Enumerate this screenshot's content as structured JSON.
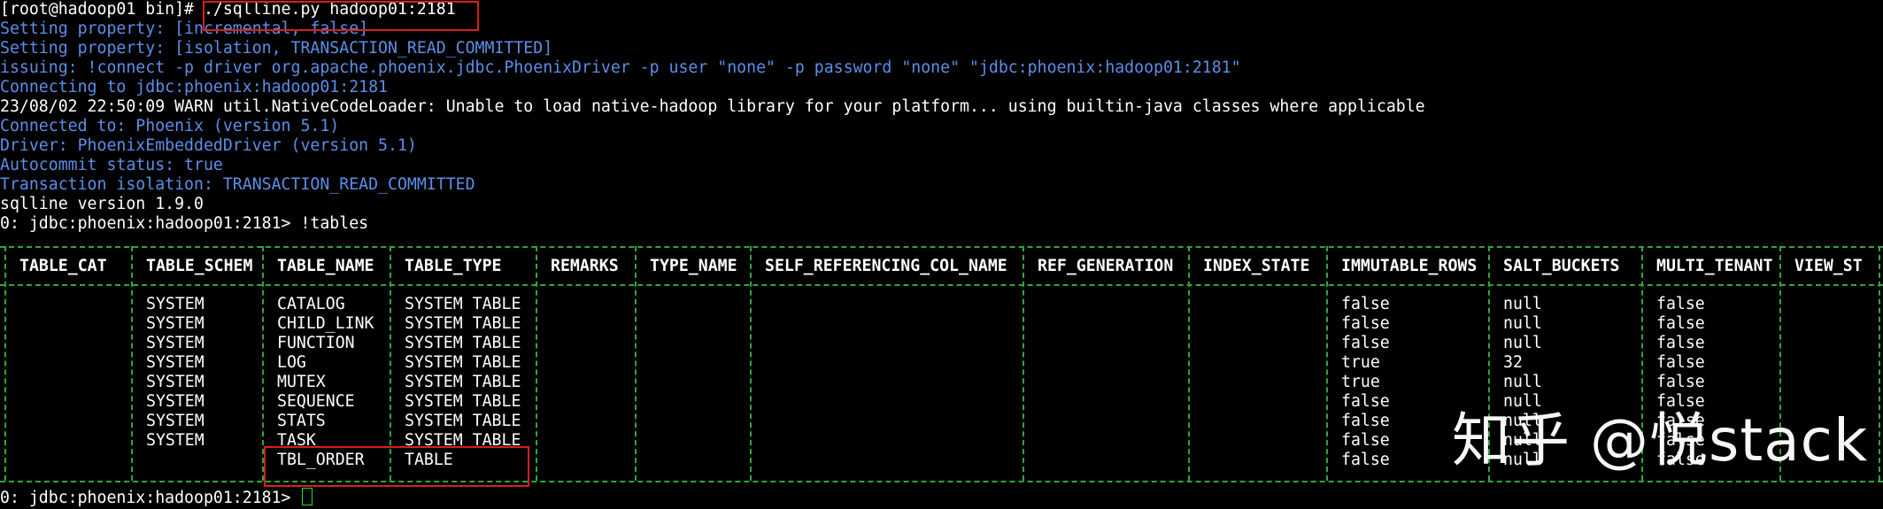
{
  "terminal": {
    "prompt_line": {
      "prompt": "[root@hadoop01 bin]# ",
      "command": "./sqlline.py hadoop01:2181"
    },
    "lines": [
      {
        "text": "Setting property: [incremental, false]",
        "color": "blue"
      },
      {
        "text": "Setting property: [isolation, TRANSACTION_READ_COMMITTED]",
        "color": "blue"
      },
      {
        "text": "issuing: !connect -p driver org.apache.phoenix.jdbc.PhoenixDriver -p user \"none\" -p password \"none\" \"jdbc:phoenix:hadoop01:2181\"",
        "color": "blue"
      },
      {
        "text": "Connecting to jdbc:phoenix:hadoop01:2181",
        "color": "blue"
      },
      {
        "text": "23/08/02 22:50:09 WARN util.NativeCodeLoader: Unable to load native-hadoop library for your platform... using builtin-java classes where applicable",
        "color": "white"
      },
      {
        "text": "Connected to: Phoenix (version 5.1)",
        "color": "blue"
      },
      {
        "text": "Driver: PhoenixEmbeddedDriver (version 5.1)",
        "color": "blue"
      },
      {
        "text": "Autocommit status: true",
        "color": "blue"
      },
      {
        "text": "Transaction isolation: TRANSACTION_READ_COMMITTED",
        "color": "blue"
      },
      {
        "text": "sqlline version 1.9.0",
        "color": "white"
      },
      {
        "text": "0: jdbc:phoenix:hadoop01:2181> !tables",
        "color": "white"
      }
    ],
    "final_prompt": "0: jdbc:phoenix:hadoop01:2181> "
  },
  "table": {
    "columns": [
      "TABLE_CAT",
      "TABLE_SCHEM",
      "TABLE_NAME",
      "TABLE_TYPE",
      "REMARKS",
      "TYPE_NAME",
      "SELF_REFERENCING_COL_NAME",
      "REF_GENERATION",
      "INDEX_STATE",
      "IMMUTABLE_ROWS",
      "SALT_BUCKETS",
      "MULTI_TENANT",
      "VIEW_ST"
    ],
    "rows": [
      [
        "",
        "SYSTEM",
        "CATALOG",
        "SYSTEM TABLE",
        "",
        "",
        "",
        "",
        "",
        "false",
        "null",
        "false",
        ""
      ],
      [
        "",
        "SYSTEM",
        "CHILD_LINK",
        "SYSTEM TABLE",
        "",
        "",
        "",
        "",
        "",
        "false",
        "null",
        "false",
        ""
      ],
      [
        "",
        "SYSTEM",
        "FUNCTION",
        "SYSTEM TABLE",
        "",
        "",
        "",
        "",
        "",
        "false",
        "null",
        "false",
        ""
      ],
      [
        "",
        "SYSTEM",
        "LOG",
        "SYSTEM TABLE",
        "",
        "",
        "",
        "",
        "",
        "true",
        "32",
        "false",
        ""
      ],
      [
        "",
        "SYSTEM",
        "MUTEX",
        "SYSTEM TABLE",
        "",
        "",
        "",
        "",
        "",
        "true",
        "null",
        "false",
        ""
      ],
      [
        "",
        "SYSTEM",
        "SEQUENCE",
        "SYSTEM TABLE",
        "",
        "",
        "",
        "",
        "",
        "false",
        "null",
        "false",
        ""
      ],
      [
        "",
        "SYSTEM",
        "STATS",
        "SYSTEM TABLE",
        "",
        "",
        "",
        "",
        "",
        "false",
        "null",
        "false",
        ""
      ],
      [
        "",
        "SYSTEM",
        "TASK",
        "SYSTEM TABLE",
        "",
        "",
        "",
        "",
        "",
        "false",
        "null",
        "false",
        ""
      ],
      [
        "",
        "",
        "TBL_ORDER",
        "TABLE",
        "",
        "",
        "",
        "",
        "",
        "false",
        "null",
        "false",
        ""
      ]
    ]
  },
  "watermark": "知乎 @悦stack",
  "colors": {
    "background": "#000000",
    "text": "#ffffff",
    "info_blue": "#5c8fe8",
    "table_border": "#2fa83a",
    "highlight_red": "#d81e1e",
    "cursor": "#22dd44"
  }
}
